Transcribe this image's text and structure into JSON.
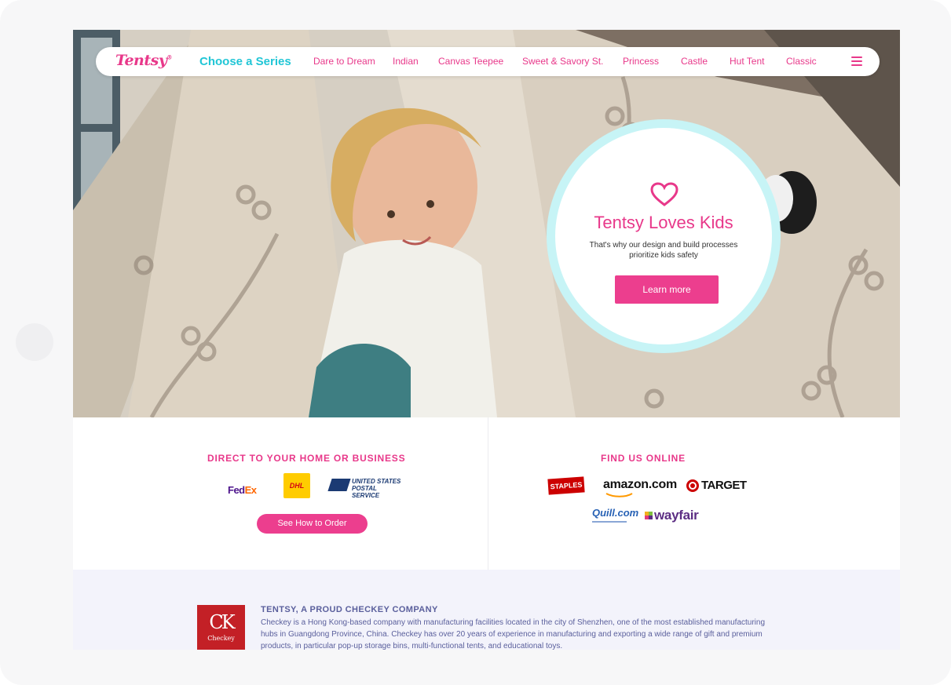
{
  "nav": {
    "logo": "Tentsy",
    "series_title": "Choose a Series",
    "items": [
      "Dare to Dream",
      "Indian",
      "Canvas Teepee",
      "Sweet & Savory St.",
      "Princess",
      "Castle",
      "Hut Tent",
      "Classic"
    ]
  },
  "hero": {
    "title": "Tentsy Loves Kids",
    "text": "That's why our design and build processes prioritize kids safety",
    "button": "Learn more"
  },
  "shipping": {
    "title": "DIRECT TO YOUR HOME OR BUSINESS",
    "fedex_fe": "Fed",
    "fedex_ex": "Ex",
    "dhl": "DHL",
    "usps_line1": "UNITED STATES",
    "usps_line2": "POSTAL SERVICE",
    "button": "See How to Order"
  },
  "online": {
    "title": "FIND US ONLINE",
    "staples": "STAPLES",
    "amazon": "amazon.com",
    "target": "TARGET",
    "quill": "Quill.com",
    "wayfair": "wayfair"
  },
  "about": {
    "logo_mono": "CK",
    "logo_name": "Checkey",
    "title": "TENTSY, A PROUD CHECKEY COMPANY",
    "text": "Checkey is a Hong Kong-based company with manufacturing facilities located in the city of Shenzhen, one of the most established manufacturing hubs in Guangdong Province, China. Checkey has over 20 years of experience in manufacturing and exporting a wide range of gift and premium products, in particular pop-up storage bins, multi-functional tents, and educational toys."
  },
  "colors": {
    "brand_pink": "#e8388a",
    "brand_cyan": "#21c6d6",
    "ring": "#c7f4f6"
  }
}
